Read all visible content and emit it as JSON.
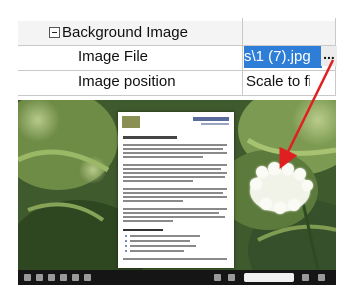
{
  "property_grid": {
    "category": {
      "label": "Background Image",
      "expander_symbol": "minus"
    },
    "rows": [
      {
        "name": "Image File",
        "value": "s\\1 (7).jpg",
        "selected": true
      },
      {
        "name": "Image position",
        "value": "Scale to fit",
        "selected": false
      }
    ],
    "ellipsis_label": "..."
  },
  "preview": {
    "annotation_arrow_color": "#e02020",
    "background_color": "#4f6a36",
    "flower_color": "#fbfbf6",
    "toolbar_color": "#151515"
  }
}
